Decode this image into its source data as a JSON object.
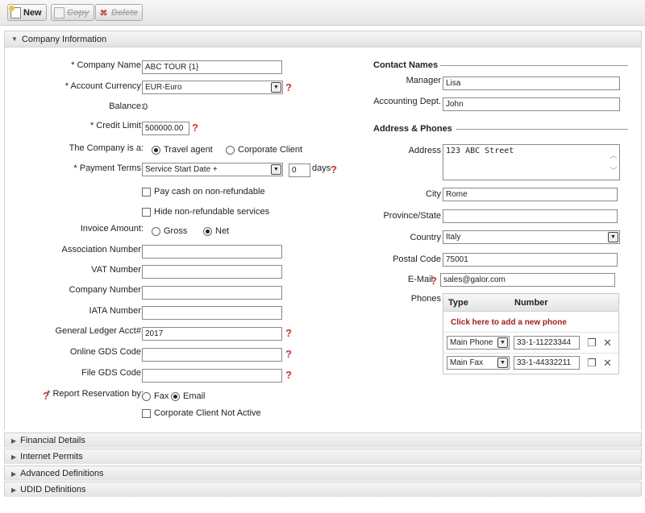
{
  "toolbar": {
    "new_label": "New",
    "copy_label": "Copy",
    "delete_label": "Delete"
  },
  "company_panel": {
    "title": "Company Information"
  },
  "form": {
    "company_name": {
      "label": "* Company Name:",
      "value": "ABC TOUR {1}"
    },
    "account_currency": {
      "label": "* Account Currency:",
      "value": "EUR-Euro"
    },
    "balance": {
      "label": "Balance:",
      "value": "0"
    },
    "credit_limit": {
      "label": "* Credit Limit:",
      "value": "500000.00"
    },
    "company_type": {
      "label": "The Company is a:",
      "option_travel": "Travel agent",
      "option_corporate": "Corporate Client"
    },
    "payment_terms": {
      "label": "* Payment Terms:",
      "value": "Service Start Date +",
      "days_value": "0",
      "days_label": "days"
    },
    "pay_cash": {
      "label": "Pay cash on non-refundable"
    },
    "hide_nonref": {
      "label": "Hide non-refundable services"
    },
    "invoice_amount": {
      "label": "Invoice Amount:",
      "option_gross": "Gross",
      "option_net": "Net"
    },
    "association_number": {
      "label": "Association Number:",
      "value": ""
    },
    "vat_number": {
      "label": "VAT Number:",
      "value": ""
    },
    "company_number": {
      "label": "Company Number:",
      "value": ""
    },
    "iata_number": {
      "label": "IATA Number:",
      "value": ""
    },
    "gl_acct": {
      "label": "General Ledger Acct#:",
      "value": "2017"
    },
    "online_gds": {
      "label": "Online GDS Code:",
      "value": ""
    },
    "file_gds": {
      "label": "File GDS Code:",
      "value": ""
    },
    "report_reservation": {
      "label": "* Report Reservation by:",
      "option_fax": "Fax",
      "option_email": "Email"
    },
    "corporate_not_active": {
      "label": "Corporate Client Not Active"
    }
  },
  "contacts": {
    "title": "Contact Names",
    "manager": {
      "label": "Manager",
      "value": "Lisa"
    },
    "accounting": {
      "label": "Accounting Dept.",
      "value": "John"
    }
  },
  "address": {
    "title": "Address & Phones",
    "address": {
      "label": "Address",
      "value": "123 ABC Street"
    },
    "city": {
      "label": "City",
      "value": "Rome"
    },
    "province": {
      "label": "Province/State",
      "value": ""
    },
    "country": {
      "label": "Country",
      "value": "Italy"
    },
    "postal_code": {
      "label": "Postal Code",
      "value": "75001"
    },
    "email": {
      "label": "E-Mail",
      "value": "sales@galor.com"
    },
    "phones": {
      "label": "Phones",
      "col_type": "Type",
      "col_number": "Number",
      "add_link": "Click here to add a new phone",
      "rows": [
        {
          "type": "Main Phone",
          "number": "33-1-11223344"
        },
        {
          "type": "Main Fax",
          "number": "33-1-44332211"
        }
      ]
    }
  },
  "sections": {
    "financial": "Financial Details",
    "internet": "Internet Permits",
    "advanced": "Advanced Definitions",
    "udid": "UDID Definitions"
  }
}
